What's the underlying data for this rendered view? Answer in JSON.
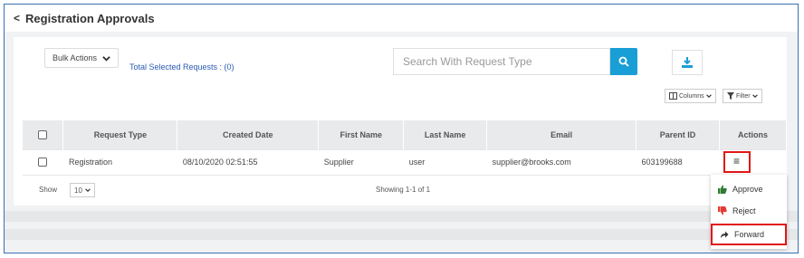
{
  "header": {
    "back_glyph": "<",
    "title": "Registration Approvals"
  },
  "toolbar": {
    "bulk_actions_label": "Bulk Actions",
    "total_selected": "Total Selected Requests : (0)",
    "search_placeholder": "Search With Request Type"
  },
  "table_controls": {
    "columns_label": "Columns",
    "filter_label": "Filter"
  },
  "table": {
    "headers": [
      "Request Type",
      "Created Date",
      "First Name",
      "Last Name",
      "Email",
      "Parent ID",
      "Actions"
    ],
    "rows": [
      {
        "request_type": "Registration",
        "created_date": "08/10/2020 02:51:55",
        "first_name": "Supplier",
        "last_name": "user",
        "email": "supplier@brooks.com",
        "parent_id": "603199688",
        "actions_glyph": "≡"
      }
    ]
  },
  "pagination": {
    "show_label": "Show",
    "page_size": "10",
    "showing_text": "Showing 1-1 of 1"
  },
  "action_menu": {
    "items": [
      "Approve",
      "Reject",
      "Forward"
    ]
  },
  "colors": {
    "accent": "#1a9ed6",
    "approve": "#2e7d32",
    "reject": "#e53935",
    "highlight": "#e01818",
    "link": "#2a5bb3"
  },
  "icons": [
    "chevron-left-icon",
    "chevron-down-icon",
    "search-icon",
    "download-icon",
    "columns-icon",
    "filter-icon",
    "hamburger-menu-icon",
    "thumbs-up-icon",
    "thumbs-down-icon",
    "forward-arrow-icon"
  ]
}
